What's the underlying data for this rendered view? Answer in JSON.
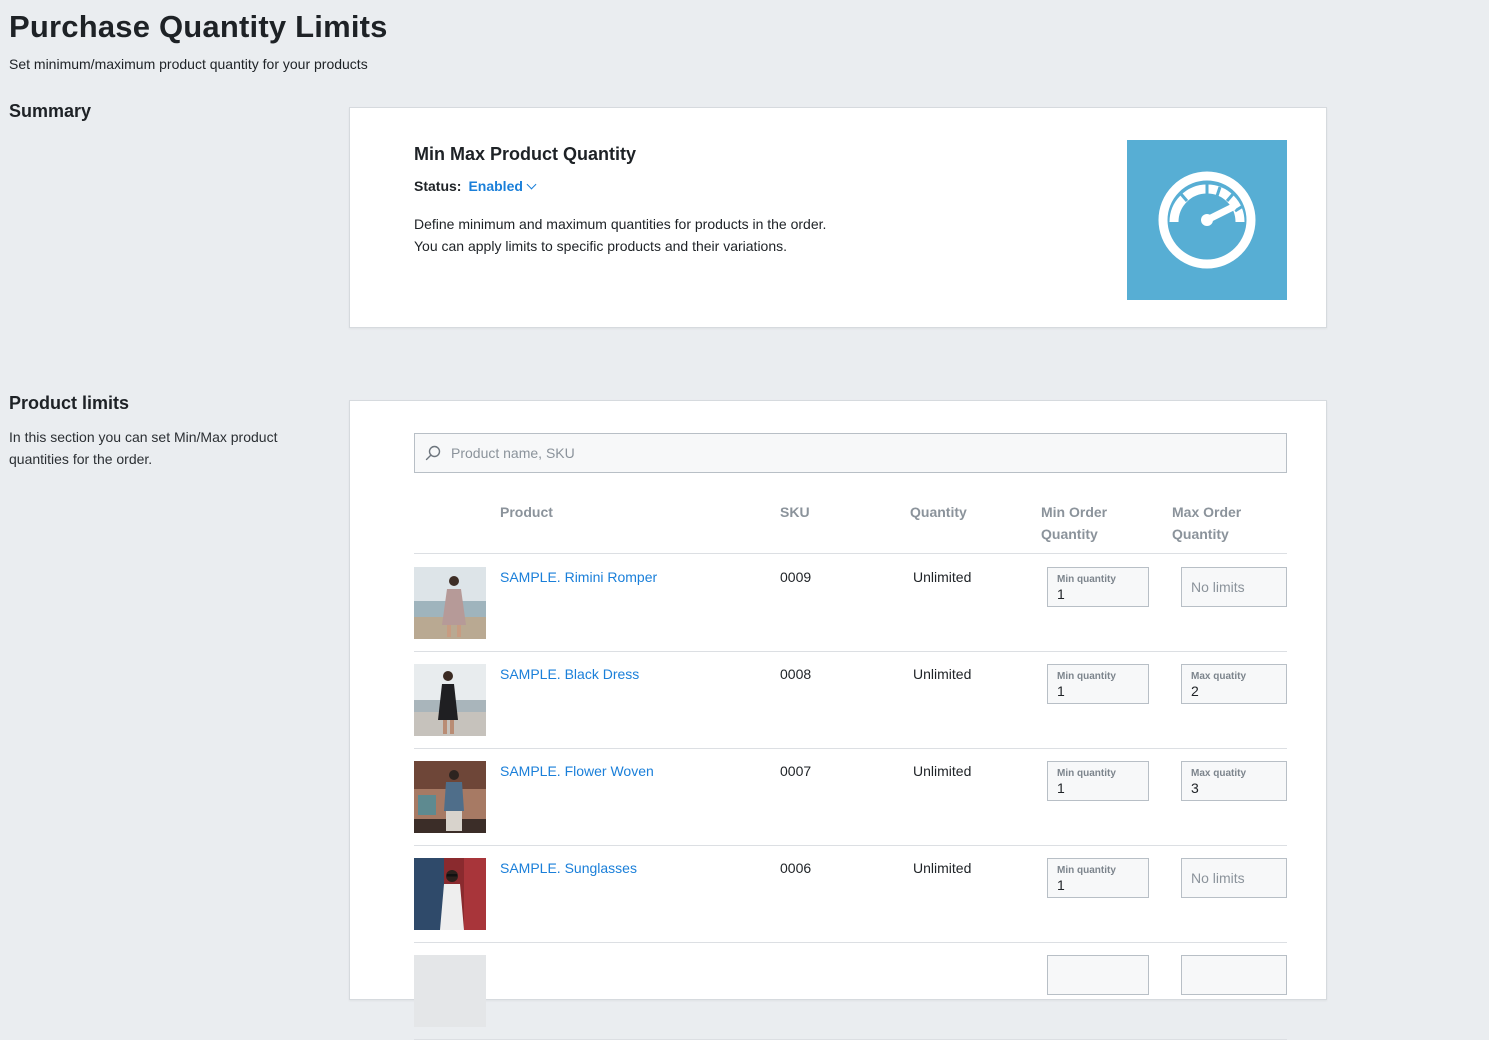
{
  "page": {
    "title": "Purchase Quantity Limits",
    "subtitle": "Set minimum/maximum product quantity for your products"
  },
  "summary": {
    "section_title": "Summary",
    "app_name": "Min Max Product Quantity",
    "status_label": "Status:",
    "status_value": "Enabled",
    "description_line1": "Define minimum and maximum quantities for products in the order.",
    "description_line2": "You can apply limits to specific products and their variations.",
    "logo_icon": "gauge-icon",
    "logo_color": "#57aed4"
  },
  "limits": {
    "section_title": "Product limits",
    "section_desc": "In this section you can set Min/Max product quantities for the order.",
    "search_placeholder": "Product name, SKU",
    "columns": {
      "product": "Product",
      "sku": "SKU",
      "quantity": "Quantity",
      "min_line1": "Min Order",
      "min_line2": "Quantity",
      "max_line1": "Max Order",
      "max_line2": "Quantity"
    },
    "rows": [
      {
        "name": "SAMPLE. Rimini Romper",
        "sku": "0009",
        "quantity": "Unlimited",
        "min_label": "Min quantity",
        "min_value": "1",
        "max_label": "",
        "max_value": "",
        "max_placeholder": "No limits"
      },
      {
        "name": "SAMPLE. Black Dress",
        "sku": "0008",
        "quantity": "Unlimited",
        "min_label": "Min quantity",
        "min_value": "1",
        "max_label": "Max quatity",
        "max_value": "2",
        "max_placeholder": ""
      },
      {
        "name": "SAMPLE. Flower Woven",
        "sku": "0007",
        "quantity": "Unlimited",
        "min_label": "Min quantity",
        "min_value": "1",
        "max_label": "Max quatity",
        "max_value": "3",
        "max_placeholder": ""
      },
      {
        "name": "SAMPLE. Sunglasses",
        "sku": "0006",
        "quantity": "Unlimited",
        "min_label": "Min quantity",
        "min_value": "1",
        "max_label": "",
        "max_value": "",
        "max_placeholder": "No limits"
      }
    ]
  },
  "colors": {
    "link": "#1a7fd9",
    "background": "#eaedf0"
  }
}
